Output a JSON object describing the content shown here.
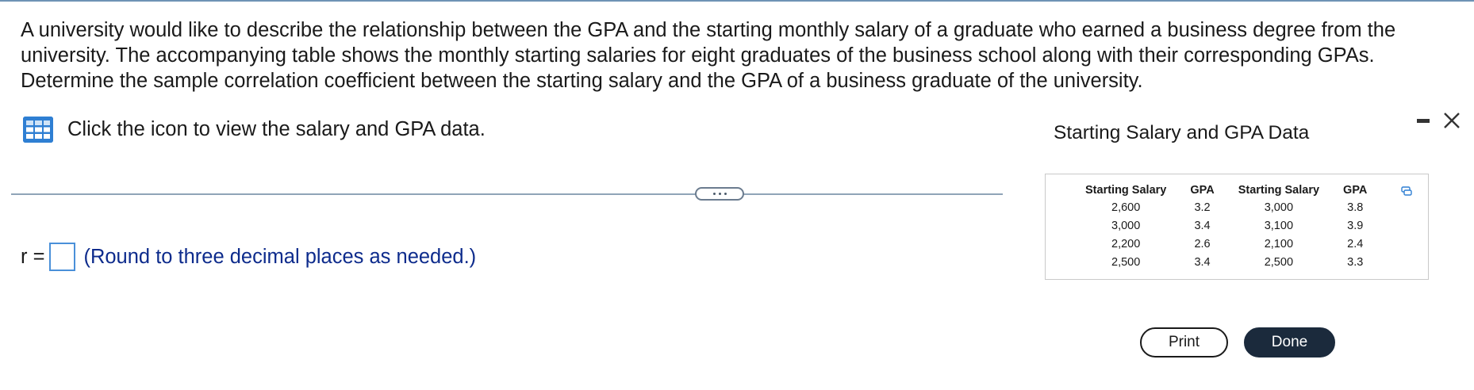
{
  "question": {
    "text": "A university would like to describe the relationship between the GPA and the starting monthly salary of a graduate who earned a business degree from the university. The accompanying table shows the monthly starting salaries for eight graduates of the business school along with their corresponding GPAs. Determine the sample correlation coefficient between the starting salary and the GPA of a business graduate of the university."
  },
  "data_link": {
    "icon": "table-icon",
    "text": "Click the icon to view the salary and GPA data."
  },
  "answer": {
    "label": "r =",
    "value": "",
    "hint": "(Round to three decimal places as needed.)"
  },
  "panel": {
    "title": "Starting Salary and GPA Data",
    "headers": [
      "Starting Salary",
      "GPA",
      "Starting Salary",
      "GPA"
    ],
    "rows": [
      [
        "2,600",
        "3.2",
        "3,000",
        "3.8"
      ],
      [
        "3,000",
        "3.4",
        "3,100",
        "3.9"
      ],
      [
        "2,200",
        "2.6",
        "2,100",
        "2.4"
      ],
      [
        "2,500",
        "3.4",
        "2,500",
        "3.3"
      ]
    ],
    "print_label": "Print",
    "done_label": "Done"
  },
  "colors": {
    "accent_blue": "#2f7fd3",
    "hint_text": "#0d2b8c",
    "done_button": "#1b2a3c"
  }
}
